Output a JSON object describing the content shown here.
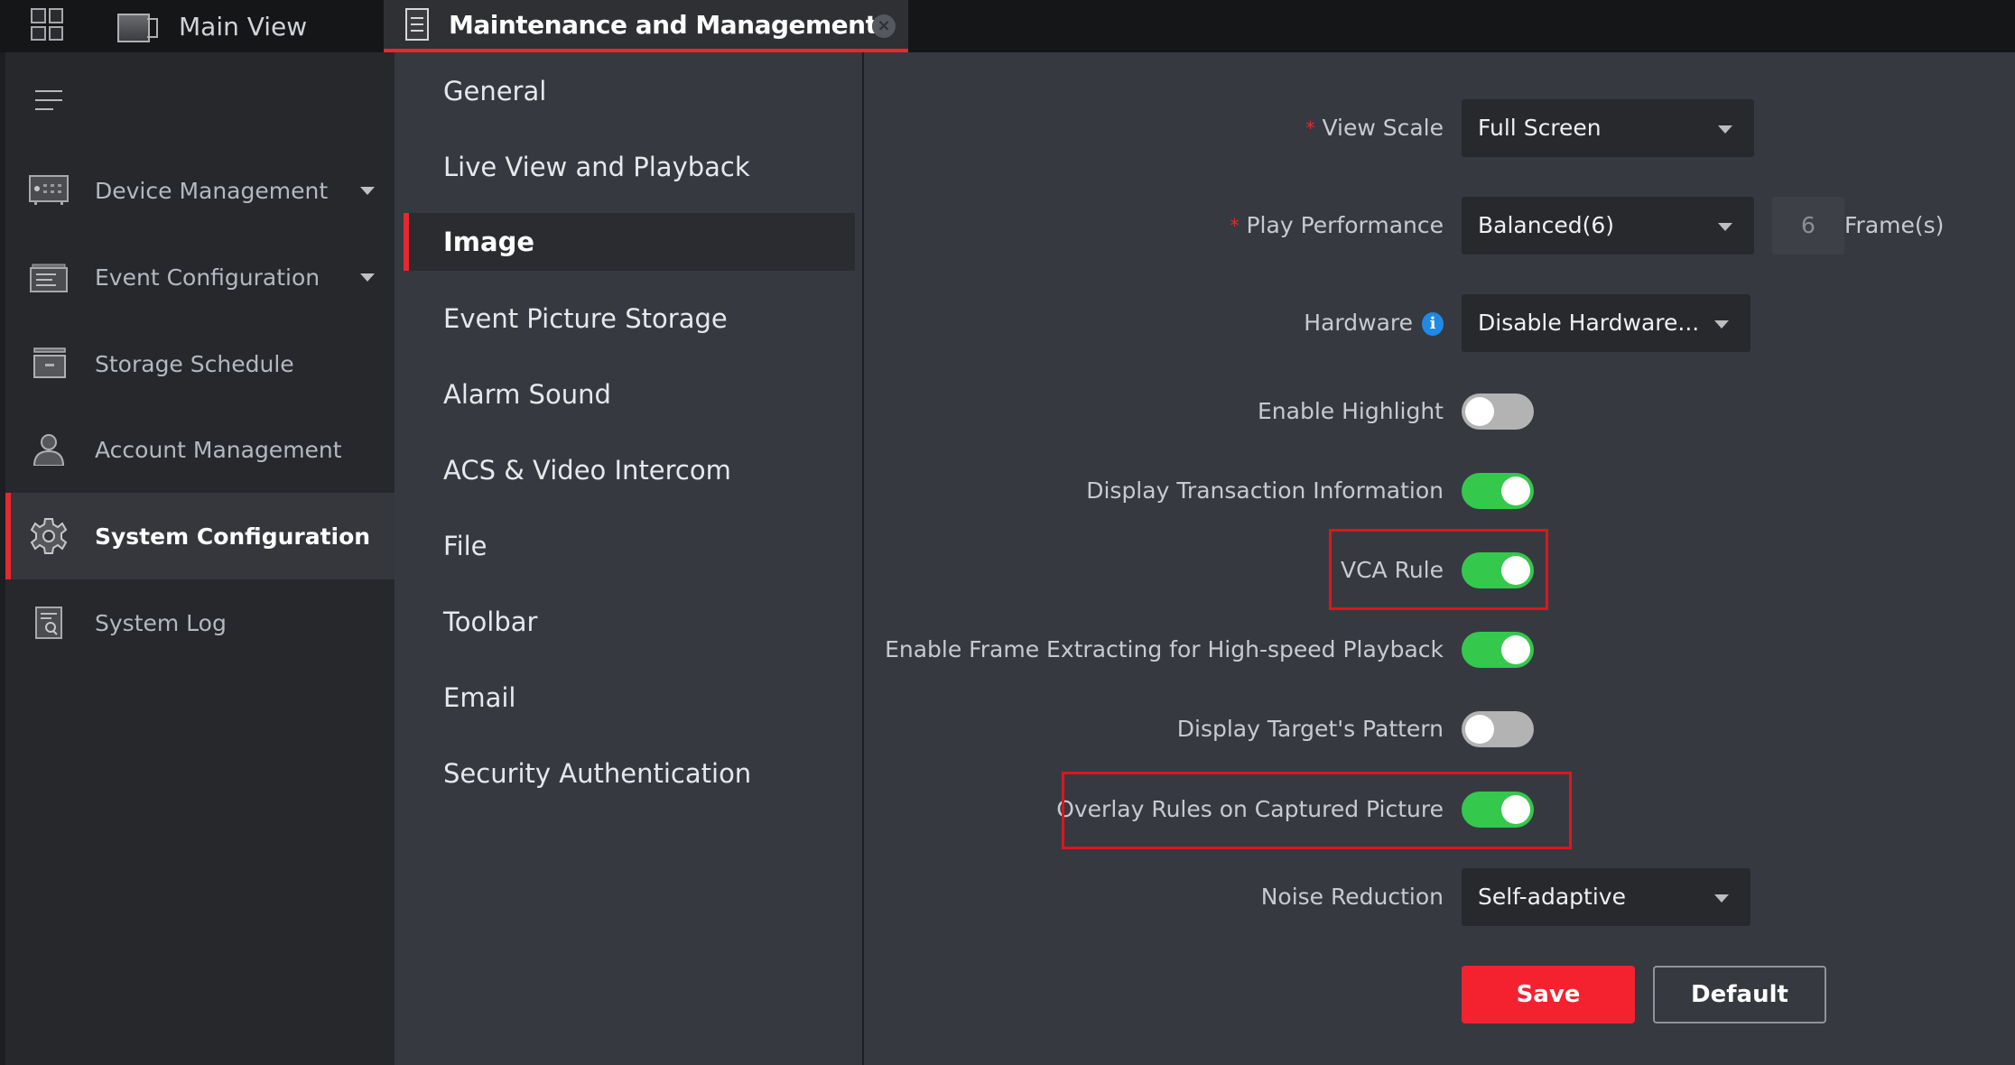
{
  "topbar": {
    "tabs": [
      {
        "label": "Main View",
        "icon": "camera-icon",
        "active": false
      },
      {
        "label": "Maintenance and Management",
        "icon": "settings-doc-icon",
        "active": true,
        "close_icon": "close-icon",
        "close_glyph": "×"
      }
    ],
    "app_menu_icon": "grid-icon"
  },
  "sidebar": {
    "collapse_icon": "hamburger-icon",
    "items": [
      {
        "label": "Device Management",
        "icon": "device-icon",
        "expandable": true
      },
      {
        "label": "Event Configuration",
        "icon": "event-icon",
        "expandable": true
      },
      {
        "label": "Storage Schedule",
        "icon": "storage-icon",
        "expandable": false
      },
      {
        "label": "Account Management",
        "icon": "user-icon",
        "expandable": false
      },
      {
        "label": "System Configuration",
        "icon": "gear-icon",
        "expandable": false,
        "active": true
      },
      {
        "label": "System Log",
        "icon": "log-icon",
        "expandable": false
      }
    ]
  },
  "submenu": {
    "items": [
      {
        "label": "General"
      },
      {
        "label": "Live View and Playback"
      },
      {
        "label": "Image",
        "active": true
      },
      {
        "label": "Event Picture Storage"
      },
      {
        "label": "Alarm Sound"
      },
      {
        "label": "ACS & Video Intercom"
      },
      {
        "label": "File"
      },
      {
        "label": "Toolbar"
      },
      {
        "label": "Email"
      },
      {
        "label": "Security Authentication"
      }
    ]
  },
  "form": {
    "required_mark": "*",
    "view_scale": {
      "label": "View Scale",
      "value": "Full Screen",
      "required": true
    },
    "play_performance": {
      "label": "Play Performance",
      "value": "Balanced(6)",
      "required": true,
      "frames_value": "6",
      "frames_unit": "Frame(s)"
    },
    "hardware": {
      "label": "Hardware",
      "value": "Disable Hardware...",
      "info_glyph": "i"
    },
    "toggles": [
      {
        "label": "Enable Highlight",
        "on": false
      },
      {
        "label": "Display Transaction Information",
        "on": true
      },
      {
        "label": "VCA Rule",
        "on": true,
        "highlighted": true
      },
      {
        "label": "Enable Frame Extracting for High-speed Playback",
        "on": true
      },
      {
        "label": "Display Target's Pattern",
        "on": false
      },
      {
        "label": "Overlay Rules on Captured Picture",
        "on": true,
        "highlighted": true
      }
    ],
    "noise_reduction": {
      "label": "Noise Reduction",
      "value": "Self-adaptive"
    },
    "save_label": "Save",
    "default_label": "Default"
  },
  "colors": {
    "accent_red": "#e82730",
    "save_red": "#f4222f",
    "toggle_on": "#34c84d",
    "toggle_off": "#b3b3b3",
    "info_blue": "#1f8ae6",
    "highlight_box": "#e0141e"
  }
}
